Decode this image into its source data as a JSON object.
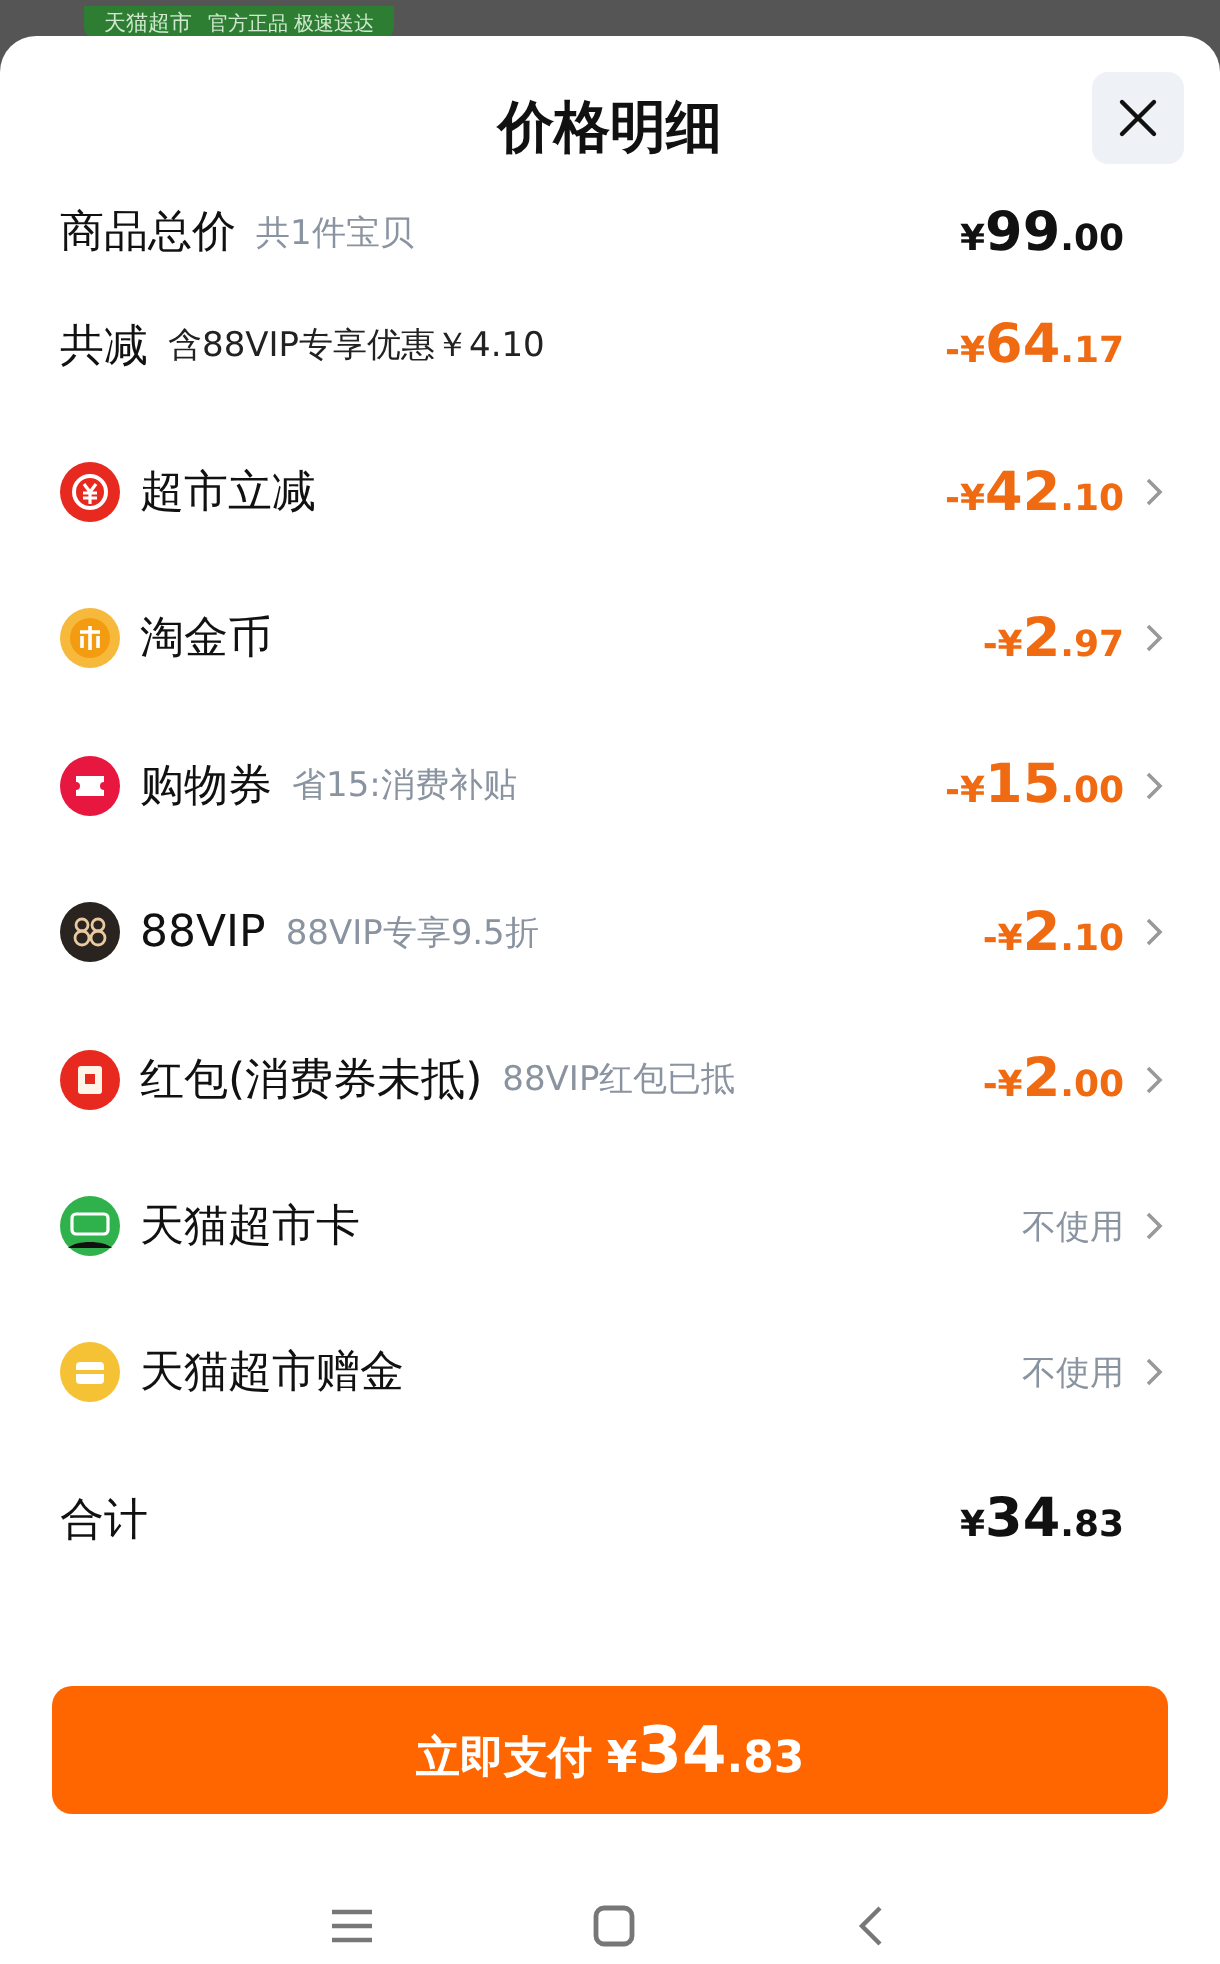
{
  "backdrop": {
    "badge_title": "天猫超市",
    "badge_text": "官方正品 极速送达"
  },
  "sheet": {
    "title": "价格明细"
  },
  "rows": [
    {
      "kind": "subtotal",
      "label": "商品总价",
      "note": "共1件宝贝",
      "prefix": "¥",
      "integer": "99",
      "fraction": ".00",
      "chevron": false
    },
    {
      "kind": "reduction",
      "label": "共减",
      "note": "含88VIP专享优惠￥4.10",
      "prefix": "-¥",
      "integer": "64",
      "fraction": ".17",
      "chevron": false
    },
    {
      "kind": "discount",
      "label": "超市立减",
      "prefix": "-¥",
      "integer": "42",
      "fraction": ".10",
      "chevron": true
    },
    {
      "kind": "discount",
      "label": "淘金币",
      "prefix": "-¥",
      "integer": "2",
      "fraction": ".97",
      "chevron": true
    },
    {
      "kind": "discount",
      "label": "购物券",
      "note": "省15:消费补贴",
      "prefix": "-¥",
      "integer": "15",
      "fraction": ".00",
      "chevron": true
    },
    {
      "kind": "discount",
      "label": "88VIP",
      "note": "88VIP专享9.5折",
      "prefix": "-¥",
      "integer": "2",
      "fraction": ".10",
      "chevron": true
    },
    {
      "kind": "discount",
      "label": "红包(消费券未抵)",
      "note": "88VIP红包已抵",
      "prefix": "-¥",
      "integer": "2",
      "fraction": ".00",
      "chevron": true
    },
    {
      "kind": "option",
      "label": "天猫超市卡",
      "status": "不使用",
      "chevron": true
    },
    {
      "kind": "option",
      "label": "天猫超市赠金",
      "status": "不使用",
      "chevron": true
    },
    {
      "kind": "total",
      "label": "合计",
      "prefix": "¥",
      "integer": "34",
      "fraction": ".83",
      "chevron": false
    }
  ],
  "pay_button": {
    "label": "立即支付",
    "prefix": "¥",
    "integer": "34",
    "fraction": ".83"
  }
}
